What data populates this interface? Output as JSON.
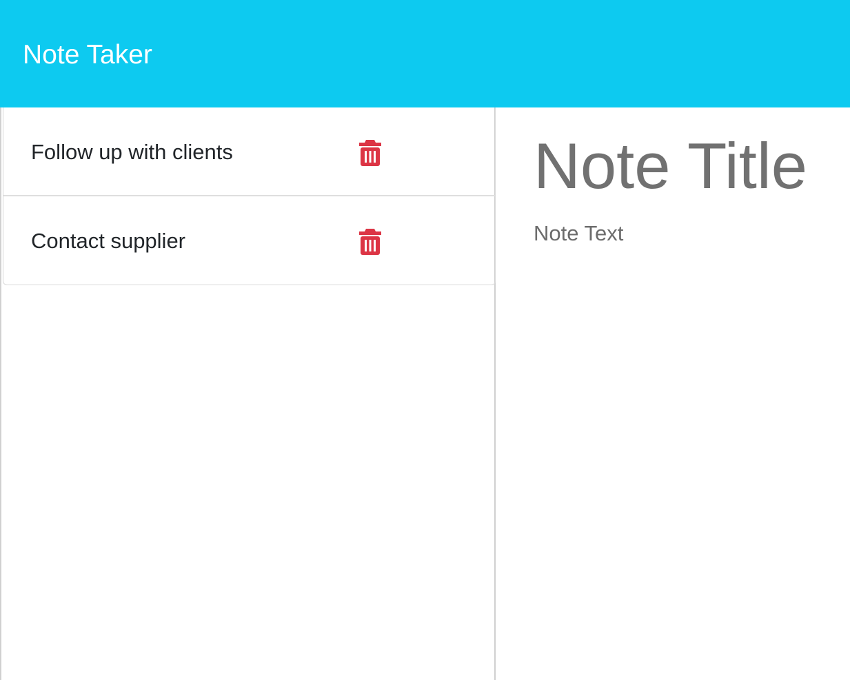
{
  "header": {
    "title": "Note Taker",
    "background_color": "#0dcaf0"
  },
  "notes": [
    {
      "title": "Follow up with clients",
      "delete_icon": "trash-icon"
    },
    {
      "title": "Contact supplier",
      "delete_icon": "trash-icon"
    }
  ],
  "editor": {
    "title_placeholder": "Note Title",
    "text_placeholder": "Note Text"
  },
  "colors": {
    "accent": "#0dcaf0",
    "delete": "#dc3545",
    "placeholder": "#717171"
  }
}
